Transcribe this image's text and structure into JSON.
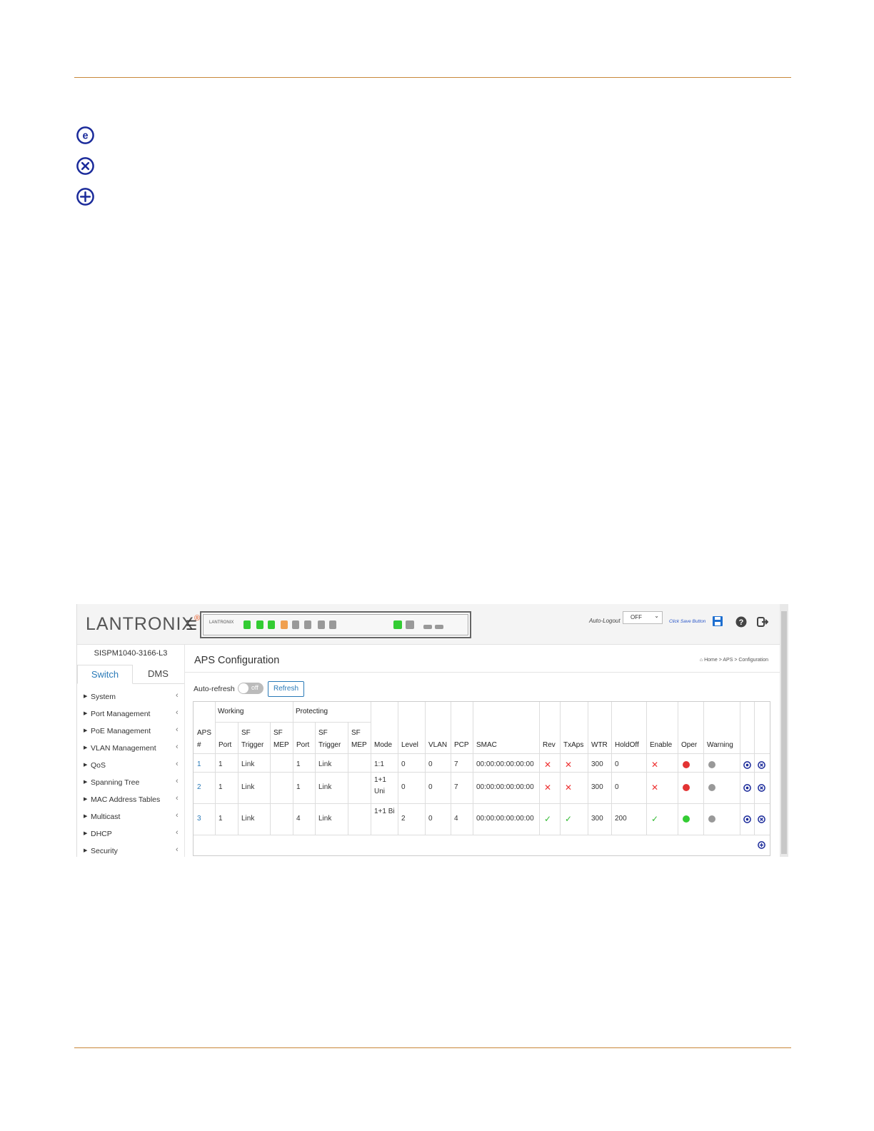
{
  "colors": {
    "rule": "#c8873a",
    "brand_orange": "#e8561f",
    "link_blue": "#2a7ab8",
    "icon_navy": "#1a2a9a",
    "status_red": "#e33333",
    "status_green": "#33cc33",
    "status_grey": "#999999"
  },
  "legend_icons": [
    "edit-icon",
    "delete-icon",
    "add-icon"
  ],
  "header": {
    "logo_text": "LANTRONIX",
    "logo_mark": "®",
    "auto_logout_label": "Auto-Logout",
    "auto_logout_value": "OFF",
    "save_hint": "Click Save Button"
  },
  "sidebar": {
    "model": "SISPM1040-3166-L3",
    "tabs": [
      "Switch",
      "DMS"
    ],
    "items": [
      "System",
      "Port Management",
      "PoE Management",
      "VLAN Management",
      "QoS",
      "Spanning Tree",
      "MAC Address Tables",
      "Multicast",
      "DHCP",
      "Security"
    ]
  },
  "main": {
    "title": "APS Configuration",
    "breadcrumb": [
      "Home",
      "APS",
      "Configuration"
    ],
    "auto_refresh_label": "Auto-refresh",
    "toggle_text": "off",
    "refresh_label": "Refresh"
  },
  "table": {
    "group_headers": {
      "working": "Working",
      "protecting": "Protecting"
    },
    "headers": [
      "APS #",
      "Port",
      "SF Trigger",
      "SF MEP",
      "Port",
      "SF Trigger",
      "SF MEP",
      "Mode",
      "Level",
      "VLAN",
      "PCP",
      "SMAC",
      "Rev",
      "TxAps",
      "WTR",
      "HoldOff",
      "Enable",
      "Oper",
      "Warning"
    ],
    "rows": [
      {
        "aps": "1",
        "w_port": "1",
        "w_trigger": "Link",
        "w_mep": "",
        "p_port": "1",
        "p_trigger": "Link",
        "p_mep": "",
        "mode": "1:1",
        "level": "0",
        "vlan": "0",
        "pcp": "7",
        "smac": "00:00:00:00:00:00",
        "rev": "✕",
        "txaps": "✕",
        "wtr": "300",
        "holdoff": "0",
        "enable": "✕",
        "oper": "red",
        "warning": "grey"
      },
      {
        "aps": "2",
        "w_port": "1",
        "w_trigger": "Link",
        "w_mep": "",
        "p_port": "1",
        "p_trigger": "Link",
        "p_mep": "",
        "mode": "1+1 Uni",
        "level": "0",
        "vlan": "0",
        "pcp": "7",
        "smac": "00:00:00:00:00:00",
        "rev": "✕",
        "txaps": "✕",
        "wtr": "300",
        "holdoff": "0",
        "enable": "✕",
        "oper": "red",
        "warning": "grey"
      },
      {
        "aps": "3",
        "w_port": "1",
        "w_trigger": "Link",
        "w_mep": "",
        "p_port": "4",
        "p_trigger": "Link",
        "p_mep": "",
        "mode": "1+1 Bi",
        "level": "2",
        "vlan": "0",
        "pcp": "4",
        "smac": "00:00:00:00:00:00",
        "rev": "✓",
        "txaps": "✓",
        "wtr": "300",
        "holdoff": "200",
        "enable": "✓",
        "oper": "green",
        "warning": "grey"
      }
    ]
  }
}
